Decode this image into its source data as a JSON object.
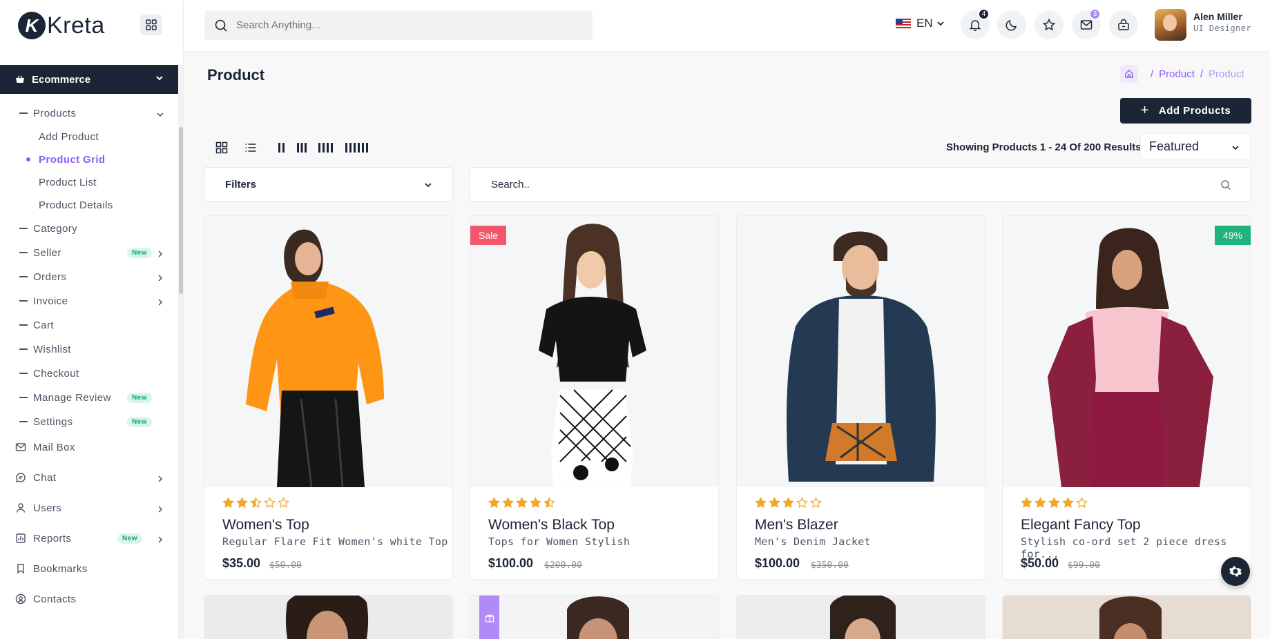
{
  "app": {
    "logo_letter": "K",
    "logo_text": "Kreta"
  },
  "sidebar": {
    "group": {
      "label": "Ecommerce"
    },
    "products_label": "Products",
    "sub_items": [
      {
        "label": "Add Product",
        "active": false
      },
      {
        "label": "Product Grid",
        "active": true
      },
      {
        "label": "Product List",
        "active": false
      },
      {
        "label": "Product Details",
        "active": false
      }
    ],
    "items": [
      {
        "label": "Category",
        "badge": "",
        "has_arrow": false
      },
      {
        "label": "Seller",
        "badge": "New",
        "has_arrow": true
      },
      {
        "label": "Orders",
        "badge": "",
        "has_arrow": true
      },
      {
        "label": "Invoice",
        "badge": "",
        "has_arrow": true
      },
      {
        "label": "Cart",
        "badge": "",
        "has_arrow": false
      },
      {
        "label": "Wishlist",
        "badge": "",
        "has_arrow": false
      },
      {
        "label": "Checkout",
        "badge": "",
        "has_arrow": false
      },
      {
        "label": "Manage Review",
        "badge": "New",
        "has_arrow": false
      },
      {
        "label": "Settings",
        "badge": "New",
        "has_arrow": false
      }
    ],
    "top_items": [
      {
        "label": "Mail Box",
        "icon": "mail-icon",
        "badge": "",
        "has_arrow": false
      },
      {
        "label": "Chat",
        "icon": "chat-icon",
        "badge": "",
        "has_arrow": true
      },
      {
        "label": "Users",
        "icon": "user-icon",
        "badge": "",
        "has_arrow": true
      },
      {
        "label": "Reports",
        "icon": "report-icon",
        "badge": "New",
        "has_arrow": true
      },
      {
        "label": "Bookmarks",
        "icon": "bookmark-icon",
        "badge": "",
        "has_arrow": false
      },
      {
        "label": "Contacts",
        "icon": "contacts-icon",
        "badge": "",
        "has_arrow": false
      }
    ]
  },
  "header": {
    "search_placeholder": "Search Anything...",
    "language": "EN",
    "notifications_count": "4",
    "messages_count": "3",
    "user_name": "Alen Miller",
    "user_role": "UI Designer"
  },
  "page": {
    "title": "Product",
    "breadcrumb": [
      "Product",
      "Product"
    ],
    "add_button": "Add Products",
    "results_text": "Showing Products 1 - 24 Of 200 Results",
    "sort_selected": "Featured",
    "filters_label": "Filters",
    "search_placeholder": "Search.."
  },
  "products": [
    {
      "name": "Women's Top",
      "desc": "Regular Flare Fit Women's white Top",
      "price": "$35.00",
      "old_price": "$50.00",
      "rating": 2.5,
      "tag": ""
    },
    {
      "name": "Women's Black Top",
      "desc": "Tops for Women Stylish",
      "price": "$100.00",
      "old_price": "$200.00",
      "rating": 4.5,
      "tag": "Sale"
    },
    {
      "name": "Men's Blazer",
      "desc": "Men's Denim Jacket",
      "price": "$100.00",
      "old_price": "$350.00",
      "rating": 3,
      "tag": ""
    },
    {
      "name": "Elegant Fancy Top",
      "desc": "Stylish co-ord set 2 piece dress for...",
      "price": "$50.00",
      "old_price": "$99.00",
      "rating": 4,
      "tag": "49%"
    }
  ],
  "colors": {
    "primary_dark": "#1c2536",
    "accent_purple": "#8d5cf6",
    "star": "#f5a623",
    "sale_tag": "#f4566b",
    "discount_tag": "#20b27c"
  }
}
